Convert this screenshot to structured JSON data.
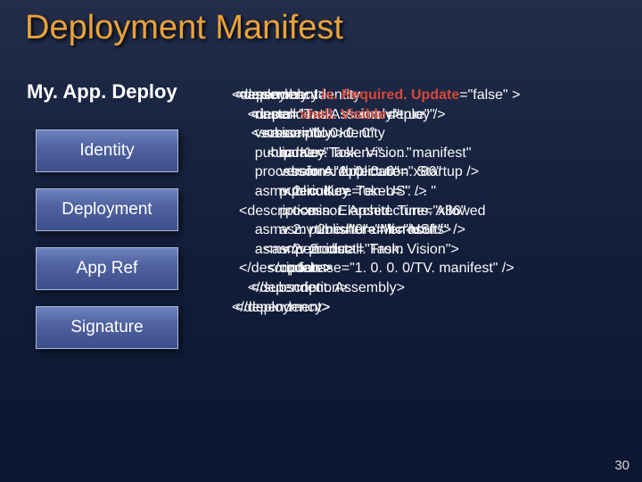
{
  "title": "Deployment Manifest",
  "subtitle": "My. App. Deploy",
  "sidebar": {
    "items": [
      {
        "label": "Identity"
      },
      {
        "label": "Deployment"
      },
      {
        "label": "App Ref"
      },
      {
        "label": "Signature"
      }
    ]
  },
  "code": {
    "dependency": "<dependency>\n    <dependent. Assembly>\n        <assembly. Identity\n            name=\"Task. Vision. manifest\"\n            version=\"1. 0. 0. 0\"\n            public. Key. Token=\". . . \"\n            processor. Architecture=\"x86\"\n            asmv 2: culture=\"en-US\" />\n        <asmv 2: install. From\n            codebase=\"1. 0. 0. 0/TV. manifest\" />\n    </dependent. Assembly>\n</dependency>",
    "identity": "<assembly. Identity\n    name=\"Task. Vision. deploy\"\n    version=\"1. 0. 0. 0\"\n    public. Key. Token=\". . . \"\n    processor. Architecture=\"x86\"\n    asmv 2: culture=\"en-US\" />\n<description\n    asmv 2: publisher=\"Microsoft\"\n    asmv 2: product=\"Task. Vision\">\n</description >",
    "deployment_line1_pre": "<deployment ",
    "deployment_line1_attr": "is. Required. Update",
    "deployment_line1_post": "=\"false\" >",
    "deployment_line2_pre": "    <install ",
    "deployment_line2_attr": "shell. Visible",
    "deployment_line2_post": "=\"true\" />",
    "deployment_rest": "    <subscription>\n        <update>\n            <before. Application. Startup />\n            <periodic>\n                <min. Elapsed. Time. Allowed\n                    time=\"0\" unit=\"hours\" />\n            </periodic>\n        </update>\n    </subscription>\n</deployment>"
  },
  "pagenum": "30"
}
